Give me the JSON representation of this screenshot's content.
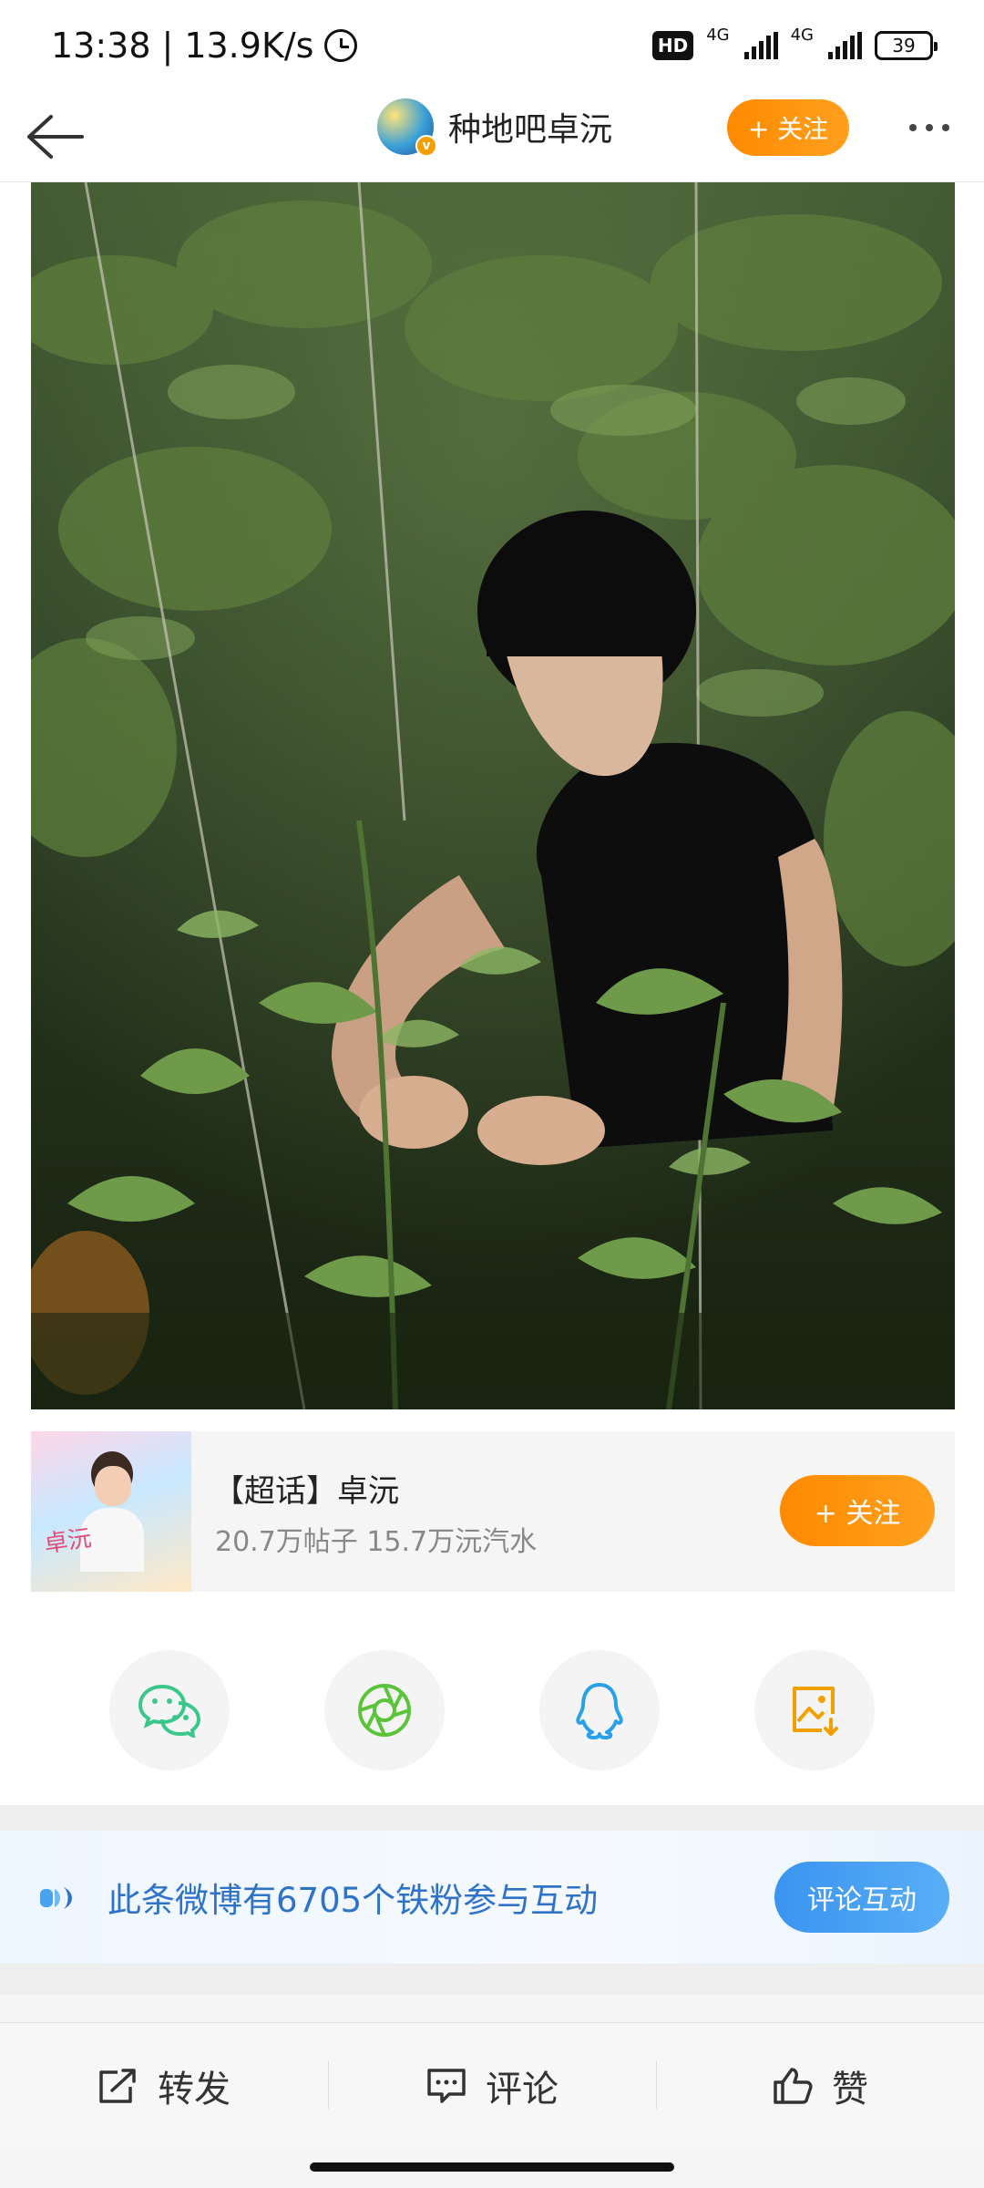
{
  "status_bar": {
    "time": "13:38",
    "speed": "13.9K/s",
    "hd": "HD",
    "net1": "4G",
    "net2": "4G",
    "battery": "39"
  },
  "nav": {
    "title": "种地吧卓沅",
    "follow_label": "+ 关注"
  },
  "topic": {
    "title": "【超话】卓沅",
    "stats": "20.7万帖子 15.7万沅汽水",
    "follow_label": "+ 关注",
    "thumb_script": "卓沅"
  },
  "share": {
    "items": [
      "wechat-icon",
      "moments-icon",
      "qq-icon",
      "save-image-icon"
    ]
  },
  "banner": {
    "text": "此条微博有6705个铁粉参与互动",
    "button_label": "评论互动"
  },
  "actions": {
    "repost": "转发",
    "comment": "评论",
    "like": "赞"
  },
  "colors": {
    "accent_orange": "#ff8a00",
    "link_blue": "#2f73c9",
    "button_blue": "#3a94f0",
    "wechat_green": "#3cc78a",
    "moments_green": "#5cc43a",
    "qq_blue": "#2aa0e8",
    "save_orange": "#f2a000"
  }
}
